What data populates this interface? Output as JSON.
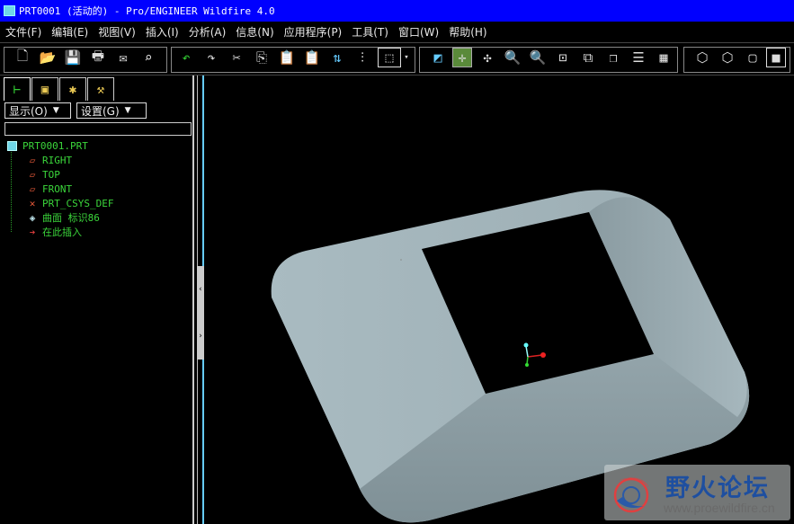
{
  "window": {
    "title": "PRT0001 (活动的) - Pro/ENGINEER Wildfire 4.0"
  },
  "menu": [
    "文件(F)",
    "编辑(E)",
    "视图(V)",
    "插入(I)",
    "分析(A)",
    "信息(N)",
    "应用程序(P)",
    "工具(T)",
    "窗口(W)",
    "帮助(H)"
  ],
  "toolbar": {
    "icons": [
      "new-icon",
      "open-icon",
      "save-icon",
      "print-icon",
      "send-icon",
      "find-icon",
      "undo-icon",
      "redo-icon",
      "cut-icon",
      "copy-icon",
      "paste-icon",
      "paste-special-icon",
      "regenerate-icon",
      "regen-manager-icon",
      "select-box-icon",
      "repaint-icon",
      "spin-center-icon",
      "orient-icon",
      "zoom-in-icon",
      "zoom-out-icon",
      "refit-icon",
      "view-manager-icon",
      "saved-views-icon",
      "layers-icon",
      "display-style-icon",
      "wireframe-icon",
      "hidden-line-icon",
      "no-hidden-icon",
      "shading-icon"
    ]
  },
  "panel": {
    "tabs": [
      "model-tree-icon",
      "folder-browser-icon",
      "favorites-icon",
      "connections-icon"
    ],
    "show_label": "显示(O)",
    "settings_label": "设置(G)",
    "filter_value": "",
    "tree": {
      "root": "PRT0001.PRT",
      "items": [
        {
          "label": "RIGHT",
          "icon": "datum-plane-icon"
        },
        {
          "label": "TOP",
          "icon": "datum-plane-icon"
        },
        {
          "label": "FRONT",
          "icon": "datum-plane-icon"
        },
        {
          "label": "PRT_CSYS_DEF",
          "icon": "csys-icon"
        },
        {
          "label": "曲面 标识86",
          "icon": "surface-icon"
        },
        {
          "label": "在此插入",
          "icon": "insert-here-icon"
        }
      ]
    }
  },
  "sash": {
    "collapse_glyph": "‹",
    "expand_glyph": "›"
  },
  "viewport": {
    "background": "#000000",
    "surface_color": "#9fb0b6",
    "shadow_color": "#7d8f95"
  },
  "watermark": {
    "text": "野火论坛",
    "url": "www.proewildfire.cn"
  }
}
